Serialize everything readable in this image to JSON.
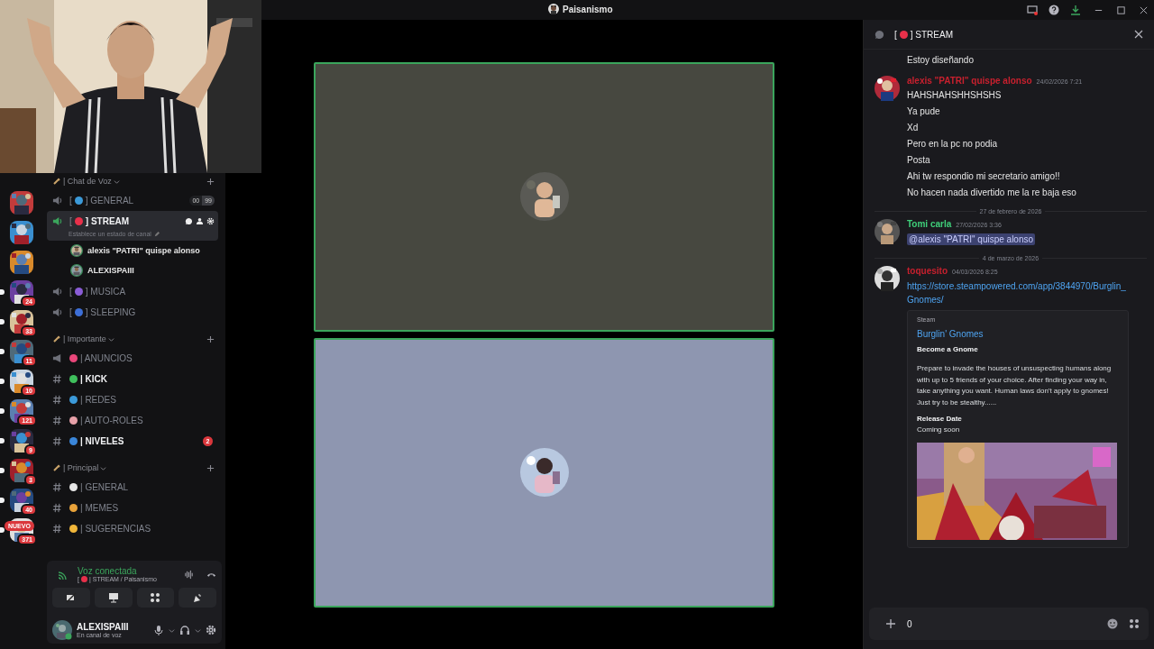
{
  "title_bar": {
    "server": "Paisanismo"
  },
  "servers": [
    {
      "unread": false
    },
    {
      "unread": false
    },
    {
      "unread": false
    },
    {
      "badge": "24",
      "unread": true
    },
    {
      "badge": "33",
      "unread": true
    },
    {
      "badge": "11",
      "unread": true
    },
    {
      "badge": "10",
      "unread": true
    },
    {
      "badge": "121",
      "unread": true
    },
    {
      "badge": "9",
      "unread": true
    },
    {
      "badge": "3",
      "unread": true
    },
    {
      "badge": "40",
      "unread": true
    },
    {
      "badge": "371",
      "unread": true
    }
  ],
  "new_pill": "NUEVO",
  "categories": [
    {
      "name": "| Chat de Voz",
      "channels": [
        {
          "kind": "voice",
          "pre": "[",
          "color": "#3b9ad9",
          "name": "] GENERAL",
          "selected": false,
          "unread": false,
          "limit": [
            "00",
            "99"
          ]
        },
        {
          "kind": "voice",
          "pre": "[",
          "color": "#e8304a",
          "name": "] STREAM",
          "selected": true,
          "unread": false,
          "status": "Establece un estado de canal",
          "users": [
            "alexis \"PATRI\" quispe alonso",
            "ALEXISPAIII"
          ]
        },
        {
          "kind": "voice",
          "pre": "[",
          "color": "#8a5cd6",
          "name": "] MUSICA",
          "selected": false,
          "unread": false
        },
        {
          "kind": "voice",
          "pre": "[",
          "color": "#3d6fd8",
          "name": "] SLEEPING",
          "selected": false,
          "unread": false
        }
      ]
    },
    {
      "name": "| Importante",
      "channels": [
        {
          "kind": "announcement",
          "color": "#e9467a",
          "name": "| ANUNCIOS",
          "selected": false,
          "unread": false
        },
        {
          "kind": "text",
          "color": "#3fbf5c",
          "name": "| KICK",
          "selected": false,
          "unread": true
        },
        {
          "kind": "text",
          "color": "#3b9ad9",
          "name": "| REDES",
          "selected": false,
          "unread": false
        },
        {
          "kind": "text",
          "color": "#e7a0a8",
          "name": "| AUTO-ROLES",
          "selected": false,
          "unread": false
        },
        {
          "kind": "text",
          "color": "#3a86d9",
          "name": "| NIVELES",
          "selected": false,
          "unread": true,
          "badge": "2"
        }
      ]
    },
    {
      "name": "| Principal",
      "channels": [
        {
          "kind": "text",
          "color": "#e6e6e6",
          "name": "| GENERAL",
          "selected": false,
          "unread": false
        },
        {
          "kind": "text",
          "color": "#e8a23a",
          "name": "| MEMES",
          "selected": false,
          "unread": false
        },
        {
          "kind": "text",
          "color": "#f0b63a",
          "name": "| SUGERENCIAS",
          "selected": false,
          "unread": false
        }
      ]
    }
  ],
  "voice_panel": {
    "status": "Voz conectada",
    "channel_pre": "[",
    "channel": "| STREAM / Paisanismo"
  },
  "user": {
    "name": "ALEXISPAIII",
    "status": "En canal de voz"
  },
  "stage": [
    {
      "speaking": true
    },
    {
      "speaking": true
    }
  ],
  "chat": {
    "pre": "[",
    "channel": "] STREAM",
    "items": [
      {
        "kind": "continuation",
        "lines": [
          "Estoy diseñando"
        ]
      },
      {
        "kind": "message",
        "author": "alexis \"PATRI\" quispe alonso",
        "color": "#c8202e",
        "time": "24/02/2026 7:21",
        "lines": [
          "HAHSHAHSHHSHSHS",
          "Ya pude",
          "Xd",
          "Pero en la pc no podia",
          "Posta",
          "Ahi tw respondio mi secretario amigo!!",
          "No hacen nada divertido me la re baja eso"
        ]
      },
      {
        "kind": "divider",
        "text": "27 de febrero de 2026"
      },
      {
        "kind": "message",
        "author": "Tomi carla",
        "color": "#3fcf7a",
        "time": "27/02/2026 3:36",
        "mention": "@alexis \"PATRI\" quispe alonso"
      },
      {
        "kind": "divider",
        "text": "4 de marzo de 2026"
      },
      {
        "kind": "message",
        "author": "toquesito",
        "color": "#c8202e",
        "time": "04/03/2026 8:25",
        "link": "https://store.steampowered.com/app/3844970/Burglin_Gnomes/",
        "embed": {
          "provider": "Steam",
          "title": "Burglin' Gnomes",
          "heading": "Become a Gnome",
          "description": "Prepare to invade the houses of unsuspecting humans along with up to 5 friends of your choice. After finding your way in, take anything you want. Human laws don't apply to gnomes! Just try to be stealthy......",
          "field_name": "Release Date",
          "field_value": "Coming soon"
        }
      }
    ],
    "composer": {
      "value": "0"
    }
  }
}
